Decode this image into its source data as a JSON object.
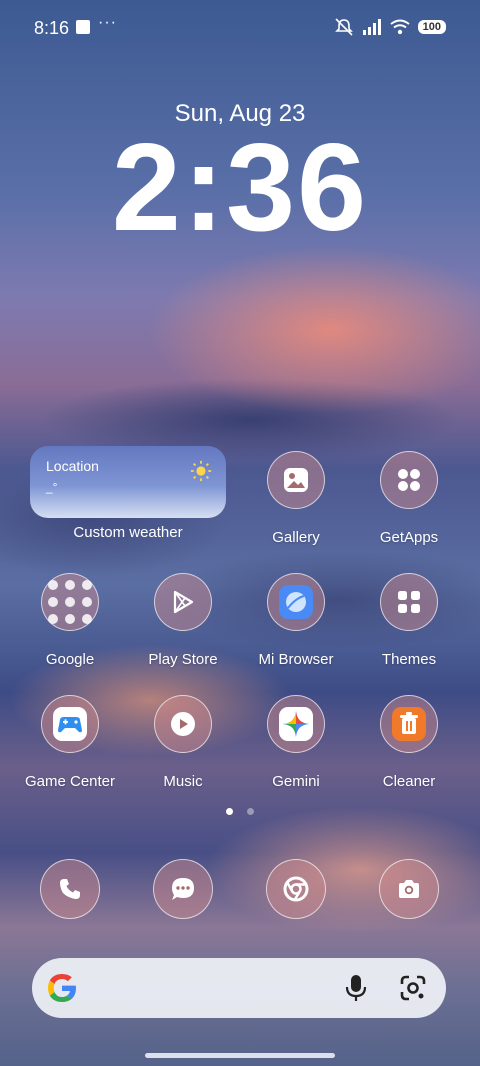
{
  "status_bar": {
    "time": "8:16",
    "dots": "···",
    "battery": "100"
  },
  "lockscreen": {
    "date": "Sun, Aug 23",
    "time": "2:36"
  },
  "weather_widget": {
    "location": "Location",
    "temp": "_°",
    "label": "Custom weather"
  },
  "apps_row1": [
    {
      "label": "Gallery"
    },
    {
      "label": "GetApps"
    }
  ],
  "apps_row2": [
    {
      "label": "Google"
    },
    {
      "label": "Play Store"
    },
    {
      "label": "Mi Browser"
    },
    {
      "label": "Themes"
    }
  ],
  "apps_row3": [
    {
      "label": "Game Center"
    },
    {
      "label": "Music"
    },
    {
      "label": "Gemini"
    },
    {
      "label": "Cleaner"
    }
  ],
  "page_indicator": {
    "current": 1,
    "total": 2
  },
  "dock": [
    "phone-icon",
    "messages-icon",
    "chrome-icon",
    "camera-icon"
  ],
  "colors": {
    "accent": "#4a8af4",
    "cleaner_orange": "#f07a2a"
  }
}
